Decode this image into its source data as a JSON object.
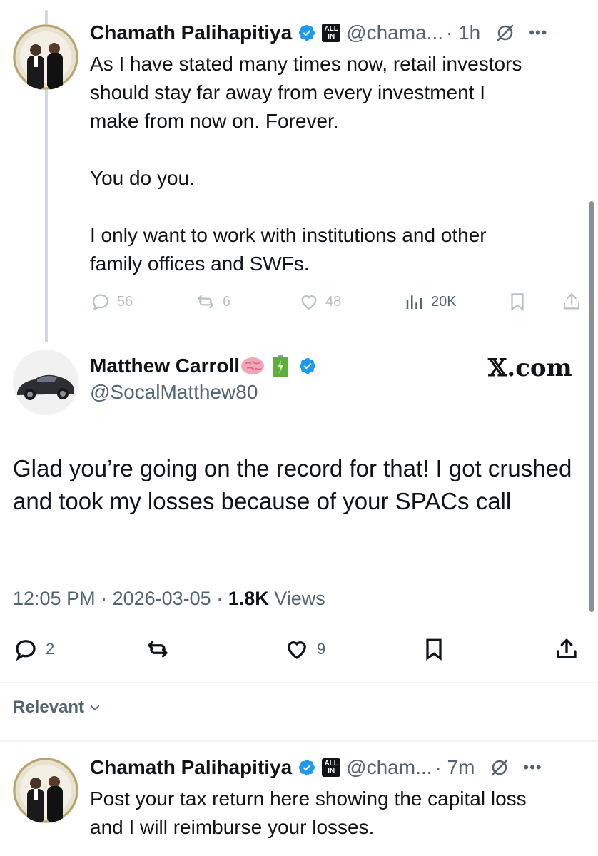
{
  "tweet1": {
    "name": "Chamath Palihapitiya",
    "badge_top": "ALL",
    "badge_bottom": "IN",
    "handle": "@chama...",
    "time": "· 1h",
    "text_lines": [
      "As I have stated many times now, retail investors",
      "should stay far away from every investment I",
      "make from now on. Forever.",
      "",
      "You do you.",
      "",
      "I only want to work with institutions and other",
      "family offices and SWFs."
    ],
    "replies": "56",
    "reposts": "6",
    "likes": "48",
    "views": "20K"
  },
  "main_tweet": {
    "name": "Matthew Carroll",
    "handle": "@SocalMatthew80",
    "emoji_1": "brain-emoji",
    "emoji_2": "battery-emoji",
    "brand": "𝕏.com",
    "text": "Glad you’re going on the record for that! I got crushed and took my losses because of your SPACs call",
    "time": "12:05 PM",
    "sep1": " · ",
    "date": "2026-03-05",
    "sep2": " · ",
    "views_count": "1.8K",
    "views_label": " Views",
    "replies": "2",
    "likes": "9"
  },
  "sort_label": "Relevant",
  "tweet3": {
    "name": "Chamath Palihapitiya",
    "badge_top": "ALL",
    "badge_bottom": "IN",
    "handle": "@cham...",
    "time": "· 7m",
    "text_lines": [
      "Post your tax return here showing the capital loss",
      "and I will reimburse your losses."
    ]
  },
  "colors": {
    "verified_blue": "#1d9bf0",
    "text_primary": "#0f1419",
    "text_secondary": "#536471",
    "faded_icon": "#b6c0c7"
  }
}
